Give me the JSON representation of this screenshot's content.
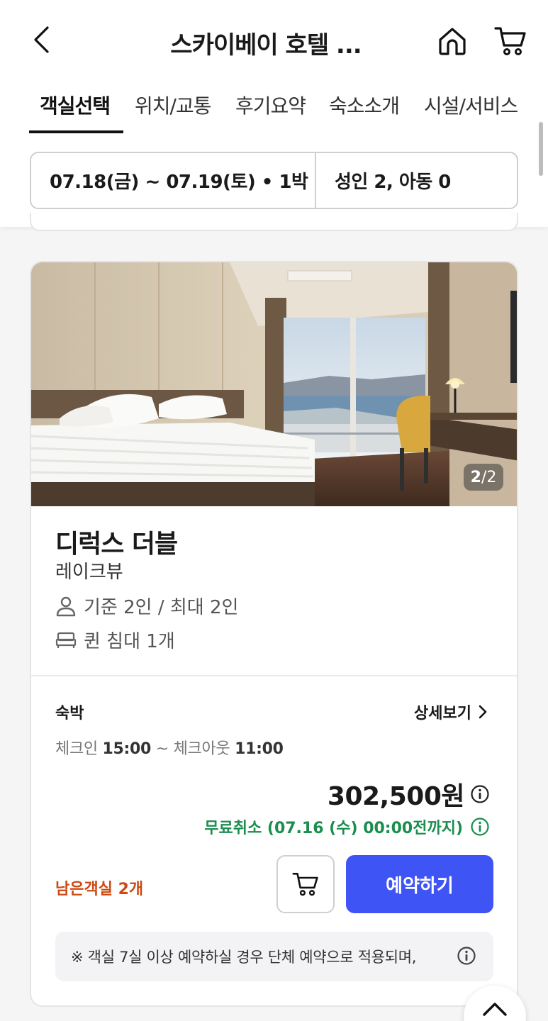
{
  "header": {
    "title": "스카이베이 호텔 ...",
    "tabs": [
      {
        "label": "객실선택"
      },
      {
        "label": "위치/교통"
      },
      {
        "label": "후기요약"
      },
      {
        "label": "숙소소개"
      },
      {
        "label": "시설/서비스"
      }
    ]
  },
  "search": {
    "dates": "07.18(금) ~ 07.19(토) • 1박",
    "guests": "성인 2, 아동 0"
  },
  "room": {
    "photo_counter_current": "2",
    "photo_counter_total": "/2",
    "name": "디럭스 더블",
    "view": "레이크뷰",
    "capacity": "기준 2인 / 최대 2인",
    "bed": "퀸 침대 1개",
    "stay_type": "숙박",
    "detail_label": "상세보기",
    "checkin_prefix": "체크인",
    "checkin_time": "15:00",
    "checkin_sep": "~ 체크아웃",
    "checkout_time": "11:00",
    "price": "302,500원",
    "free_cancel": "무료취소 (07.16 (수) 00:00전까지)",
    "remaining": "남은객실 2개",
    "reserve_label": "예약하기",
    "notice": "※ 객실 7실 이상 예약하실 경우 단체 예약으로 적용되며,"
  },
  "colors": {
    "accent": "#3f54f5",
    "free_cancel": "#1b8d4f",
    "remaining": "#cc4a12"
  }
}
